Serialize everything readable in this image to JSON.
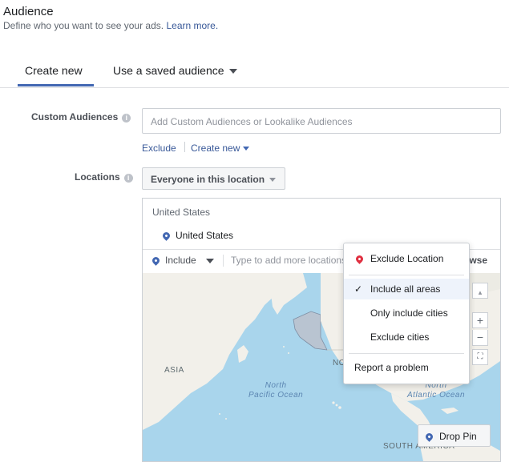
{
  "header": {
    "title": "Audience",
    "subtitle": "Define who you want to see your ads.",
    "learn_more": "Learn more."
  },
  "tabs": [
    {
      "label": "Create new",
      "active": true
    },
    {
      "label": "Use a saved audience",
      "active": false
    }
  ],
  "custom_audiences": {
    "label": "Custom Audiences",
    "placeholder": "Add Custom Audiences or Lookalike Audiences",
    "exclude": "Exclude",
    "create_new": "Create new"
  },
  "locations": {
    "label": "Locations",
    "selector": "Everyone in this location",
    "group_label": "United States",
    "selected_location": "United States",
    "include_label": "Include",
    "type_placeholder": "Type to add more locations",
    "browse": "owse"
  },
  "map": {
    "labels": {
      "asia": "ASIA",
      "north_pacific": "North\nPacific Ocean",
      "north_atlantic": "North\nAtlantic Ocean",
      "south_america": "SOUTH AMERICA",
      "north_america": "NO"
    },
    "zoom_in": "+",
    "zoom_out": "−",
    "drop_pin": "Drop Pin",
    "colors": {
      "water": "#a9d5ec",
      "land": "#f2f0ea",
      "highlight": "#9aa7b8"
    }
  },
  "dropdown_menu": {
    "exclude_location": "Exclude Location",
    "include_all_areas": "Include all areas",
    "only_include_cities": "Only include cities",
    "exclude_cities": "Exclude cities",
    "report_problem": "Report a problem",
    "selected": "include_all_areas"
  },
  "colors": {
    "accent": "#4267b2",
    "link": "#385898",
    "pin_red": "#e02f40"
  }
}
